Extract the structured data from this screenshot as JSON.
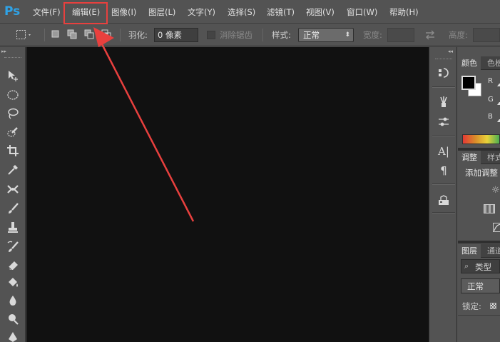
{
  "app": {
    "logo": "Ps"
  },
  "menu": [
    "文件(F)",
    "编辑(E)",
    "图像(I)",
    "图层(L)",
    "文字(Y)",
    "选择(S)",
    "滤镜(T)",
    "视图(V)",
    "窗口(W)",
    "帮助(H)"
  ],
  "options": {
    "feather_label": "羽化:",
    "feather_value": "0 像素",
    "antialias_label": "消除锯齿",
    "style_label": "样式:",
    "style_value": "正常",
    "width_label": "宽度:",
    "height_label": "高度:"
  },
  "panels": {
    "color": {
      "tabs": [
        "颜色",
        "色板"
      ],
      "channels": [
        "R",
        "G",
        "B"
      ]
    },
    "adjustments": {
      "tabs": [
        "调整",
        "样式"
      ],
      "add_label": "添加调整"
    },
    "layers": {
      "tabs": [
        "图层",
        "通道"
      ],
      "search_placeholder": "类型",
      "blend_mode": "正常",
      "lock_label": "锁定:"
    }
  },
  "colors": {
    "accent": "#2fa3e7",
    "annotation": "#e8403e",
    "canvas": "#111111",
    "ui": "#535353"
  }
}
